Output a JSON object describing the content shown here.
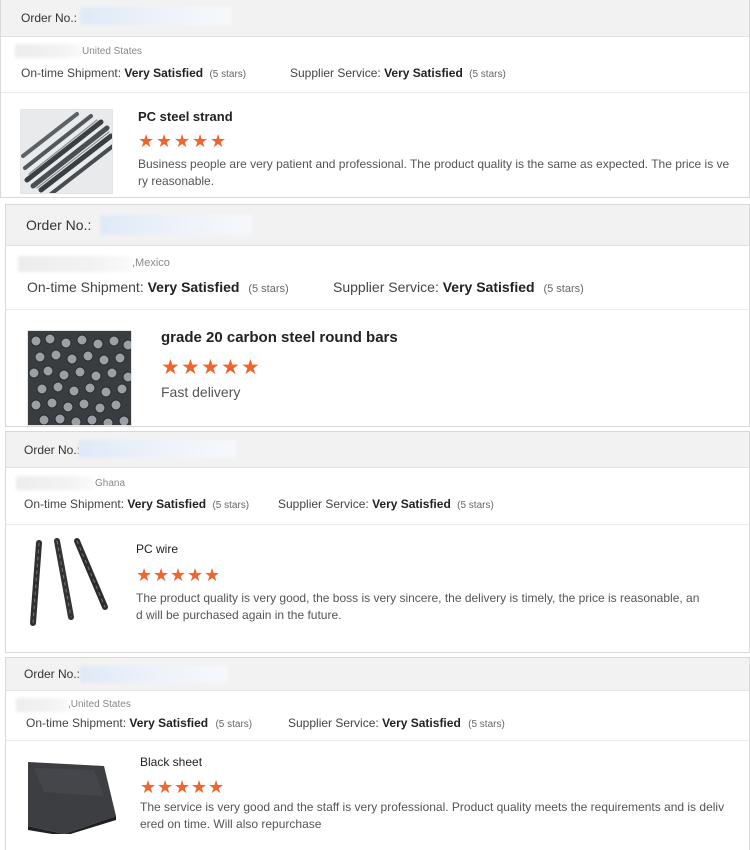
{
  "common": {
    "order_label": "Order No.:",
    "ontime_label": "On-time Shipment:",
    "supplier_label": "Supplier Service:",
    "rating_value": "Very Satisfied",
    "rating_count": "(5 stars)",
    "star_glyph": "★",
    "accent_color": "#f0652d"
  },
  "reviews": [
    {
      "country": "United States",
      "product": "PC steel strand",
      "stars": 5,
      "image": "steel-strand-image",
      "text": "Business people are very patient and professional. The product quality is the same as expected. The price is very reasonable."
    },
    {
      "country": ",Mexico",
      "product": "grade 20 carbon steel round bars",
      "stars": 5,
      "image": "round-bars-image",
      "text": "Fast delivery"
    },
    {
      "country": "Ghana",
      "product": "PC wire",
      "stars": 5,
      "image": "pc-wire-image",
      "text": "The product quality is very good, the boss is very sincere, the delivery is timely, the price is reasonable, and will be purchased again in the future."
    },
    {
      "country": ",United States",
      "product": "Black sheet",
      "stars": 5,
      "image": "black-sheet-image",
      "text": "The service is very good and the staff is very professional. Product quality meets the requirements and is delivered on time. Will also repurchase"
    }
  ]
}
